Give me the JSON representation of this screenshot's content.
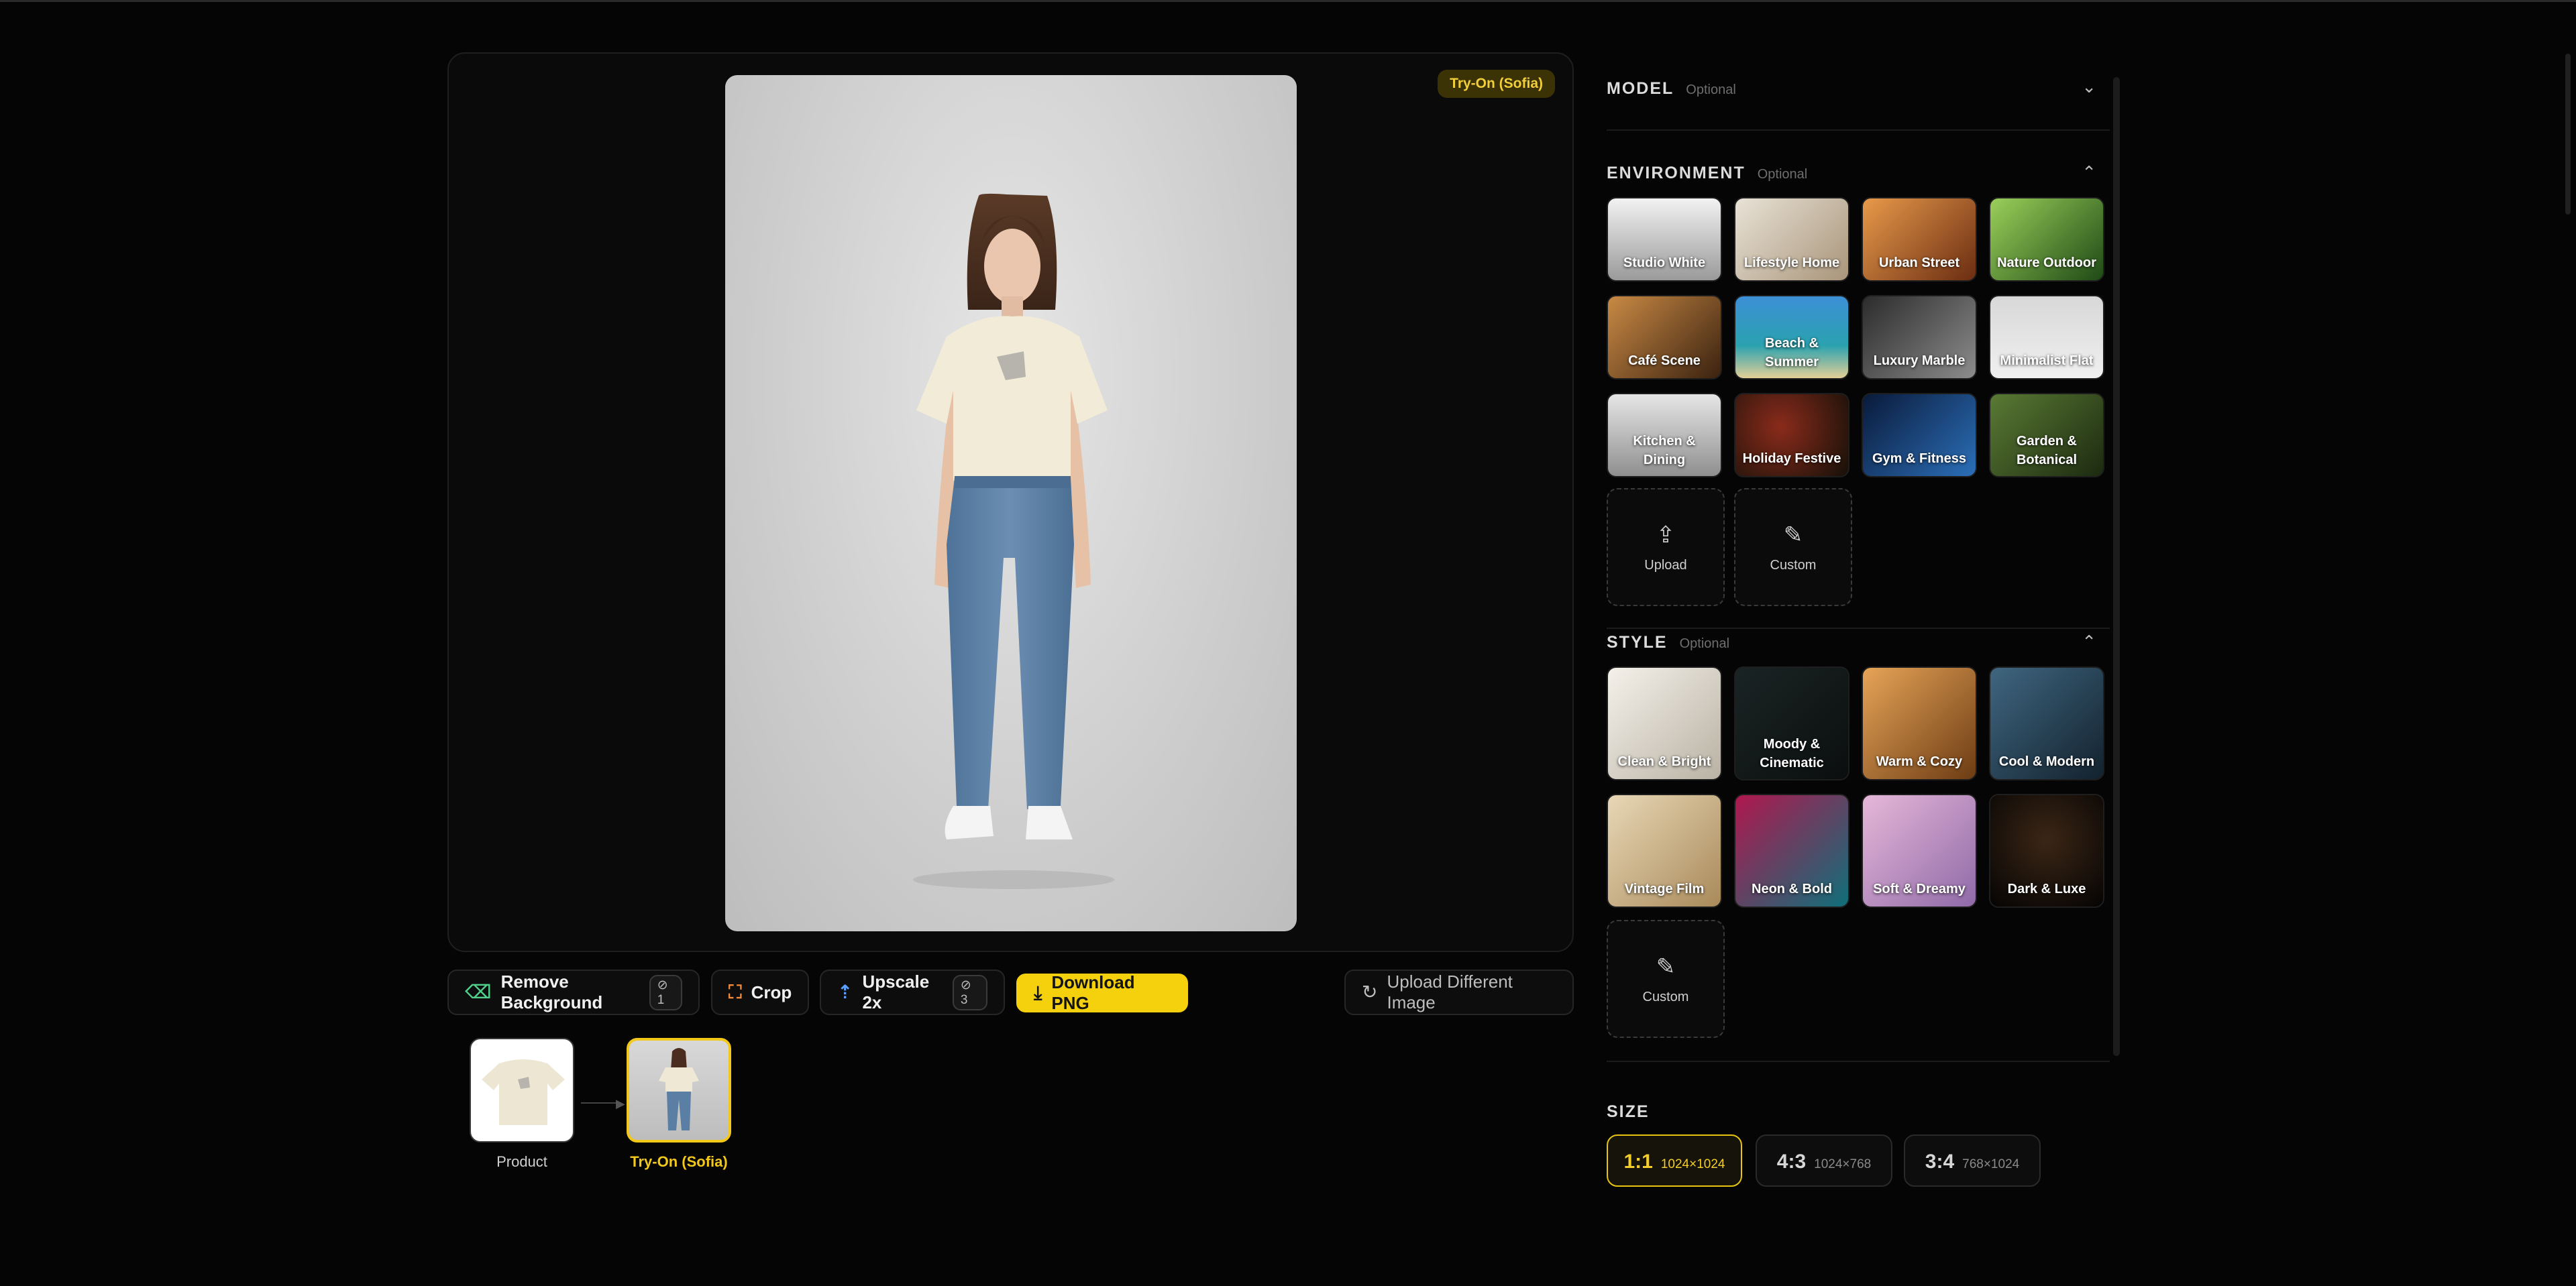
{
  "preview": {
    "badge": "Try-On (Sofia)"
  },
  "toolbar": {
    "remove_bg": {
      "label": "Remove Background",
      "credits": "1"
    },
    "crop": {
      "label": "Crop"
    },
    "upscale": {
      "label": "Upscale 2x",
      "credits": "3"
    },
    "download": {
      "label": "Download PNG"
    },
    "upload_different": {
      "label": "Upload Different Image"
    }
  },
  "history": [
    {
      "label": "Product"
    },
    {
      "label": "Try-On (Sofia)"
    }
  ],
  "sections": {
    "model": {
      "title": "MODEL",
      "optional": "Optional"
    },
    "environment": {
      "title": "ENVIRONMENT",
      "optional": "Optional",
      "items": [
        {
          "label": "Studio White"
        },
        {
          "label": "Lifestyle Home"
        },
        {
          "label": "Urban Street"
        },
        {
          "label": "Nature Outdoor"
        },
        {
          "label": "Café Scene"
        },
        {
          "label": "Beach & Summer"
        },
        {
          "label": "Luxury Marble"
        },
        {
          "label": "Minimalist Flat"
        },
        {
          "label": "Kitchen & Dining"
        },
        {
          "label": "Holiday Festive"
        },
        {
          "label": "Gym & Fitness"
        },
        {
          "label": "Garden & Botanical"
        }
      ],
      "upload": "Upload",
      "custom": "Custom"
    },
    "style": {
      "title": "STYLE",
      "optional": "Optional",
      "items": [
        {
          "label": "Clean & Bright"
        },
        {
          "label": "Moody & Cinematic"
        },
        {
          "label": "Warm & Cozy"
        },
        {
          "label": "Cool & Modern"
        },
        {
          "label": "Vintage Film"
        },
        {
          "label": "Neon & Bold"
        },
        {
          "label": "Soft & Dreamy"
        },
        {
          "label": "Dark & Luxe"
        }
      ],
      "custom": "Custom"
    },
    "size": {
      "title": "SIZE",
      "options": [
        {
          "ratio": "1:1",
          "dims": "1024×1024",
          "selected": true
        },
        {
          "ratio": "4:3",
          "dims": "1024×768",
          "selected": false
        },
        {
          "ratio": "3:4",
          "dims": "768×1024",
          "selected": false
        }
      ]
    }
  },
  "colors": {
    "accent": "#f5d10d",
    "background": "#050505",
    "panel": "#0a0a0a"
  }
}
